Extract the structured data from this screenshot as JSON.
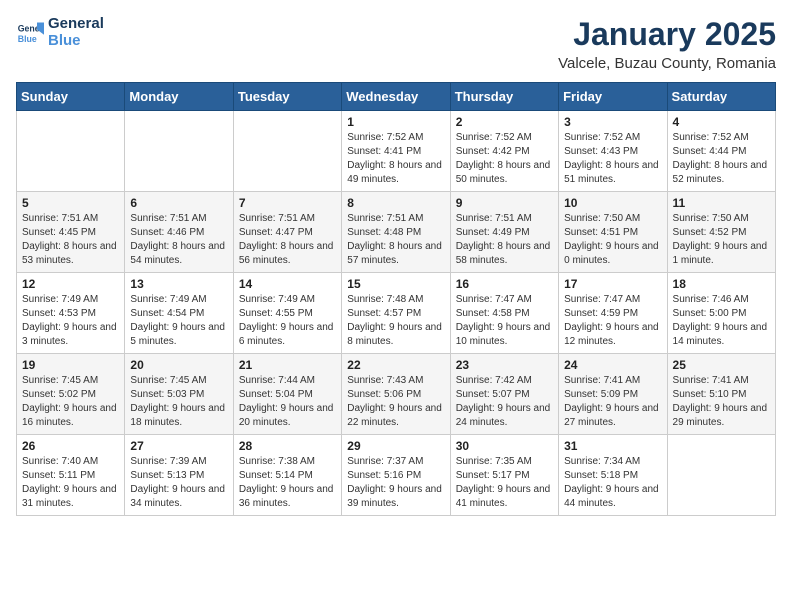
{
  "header": {
    "logo": {
      "line1": "General",
      "line2": "Blue"
    },
    "title": "January 2025",
    "subtitle": "Valcele, Buzau County, Romania"
  },
  "weekdays": [
    "Sunday",
    "Monday",
    "Tuesday",
    "Wednesday",
    "Thursday",
    "Friday",
    "Saturday"
  ],
  "weeks": [
    [
      {
        "day": "",
        "sunrise": "",
        "sunset": "",
        "daylight": ""
      },
      {
        "day": "",
        "sunrise": "",
        "sunset": "",
        "daylight": ""
      },
      {
        "day": "",
        "sunrise": "",
        "sunset": "",
        "daylight": ""
      },
      {
        "day": "1",
        "sunrise": "Sunrise: 7:52 AM",
        "sunset": "Sunset: 4:41 PM",
        "daylight": "Daylight: 8 hours and 49 minutes."
      },
      {
        "day": "2",
        "sunrise": "Sunrise: 7:52 AM",
        "sunset": "Sunset: 4:42 PM",
        "daylight": "Daylight: 8 hours and 50 minutes."
      },
      {
        "day": "3",
        "sunrise": "Sunrise: 7:52 AM",
        "sunset": "Sunset: 4:43 PM",
        "daylight": "Daylight: 8 hours and 51 minutes."
      },
      {
        "day": "4",
        "sunrise": "Sunrise: 7:52 AM",
        "sunset": "Sunset: 4:44 PM",
        "daylight": "Daylight: 8 hours and 52 minutes."
      }
    ],
    [
      {
        "day": "5",
        "sunrise": "Sunrise: 7:51 AM",
        "sunset": "Sunset: 4:45 PM",
        "daylight": "Daylight: 8 hours and 53 minutes."
      },
      {
        "day": "6",
        "sunrise": "Sunrise: 7:51 AM",
        "sunset": "Sunset: 4:46 PM",
        "daylight": "Daylight: 8 hours and 54 minutes."
      },
      {
        "day": "7",
        "sunrise": "Sunrise: 7:51 AM",
        "sunset": "Sunset: 4:47 PM",
        "daylight": "Daylight: 8 hours and 56 minutes."
      },
      {
        "day": "8",
        "sunrise": "Sunrise: 7:51 AM",
        "sunset": "Sunset: 4:48 PM",
        "daylight": "Daylight: 8 hours and 57 minutes."
      },
      {
        "day": "9",
        "sunrise": "Sunrise: 7:51 AM",
        "sunset": "Sunset: 4:49 PM",
        "daylight": "Daylight: 8 hours and 58 minutes."
      },
      {
        "day": "10",
        "sunrise": "Sunrise: 7:50 AM",
        "sunset": "Sunset: 4:51 PM",
        "daylight": "Daylight: 9 hours and 0 minutes."
      },
      {
        "day": "11",
        "sunrise": "Sunrise: 7:50 AM",
        "sunset": "Sunset: 4:52 PM",
        "daylight": "Daylight: 9 hours and 1 minute."
      }
    ],
    [
      {
        "day": "12",
        "sunrise": "Sunrise: 7:49 AM",
        "sunset": "Sunset: 4:53 PM",
        "daylight": "Daylight: 9 hours and 3 minutes."
      },
      {
        "day": "13",
        "sunrise": "Sunrise: 7:49 AM",
        "sunset": "Sunset: 4:54 PM",
        "daylight": "Daylight: 9 hours and 5 minutes."
      },
      {
        "day": "14",
        "sunrise": "Sunrise: 7:49 AM",
        "sunset": "Sunset: 4:55 PM",
        "daylight": "Daylight: 9 hours and 6 minutes."
      },
      {
        "day": "15",
        "sunrise": "Sunrise: 7:48 AM",
        "sunset": "Sunset: 4:57 PM",
        "daylight": "Daylight: 9 hours and 8 minutes."
      },
      {
        "day": "16",
        "sunrise": "Sunrise: 7:47 AM",
        "sunset": "Sunset: 4:58 PM",
        "daylight": "Daylight: 9 hours and 10 minutes."
      },
      {
        "day": "17",
        "sunrise": "Sunrise: 7:47 AM",
        "sunset": "Sunset: 4:59 PM",
        "daylight": "Daylight: 9 hours and 12 minutes."
      },
      {
        "day": "18",
        "sunrise": "Sunrise: 7:46 AM",
        "sunset": "Sunset: 5:00 PM",
        "daylight": "Daylight: 9 hours and 14 minutes."
      }
    ],
    [
      {
        "day": "19",
        "sunrise": "Sunrise: 7:45 AM",
        "sunset": "Sunset: 5:02 PM",
        "daylight": "Daylight: 9 hours and 16 minutes."
      },
      {
        "day": "20",
        "sunrise": "Sunrise: 7:45 AM",
        "sunset": "Sunset: 5:03 PM",
        "daylight": "Daylight: 9 hours and 18 minutes."
      },
      {
        "day": "21",
        "sunrise": "Sunrise: 7:44 AM",
        "sunset": "Sunset: 5:04 PM",
        "daylight": "Daylight: 9 hours and 20 minutes."
      },
      {
        "day": "22",
        "sunrise": "Sunrise: 7:43 AM",
        "sunset": "Sunset: 5:06 PM",
        "daylight": "Daylight: 9 hours and 22 minutes."
      },
      {
        "day": "23",
        "sunrise": "Sunrise: 7:42 AM",
        "sunset": "Sunset: 5:07 PM",
        "daylight": "Daylight: 9 hours and 24 minutes."
      },
      {
        "day": "24",
        "sunrise": "Sunrise: 7:41 AM",
        "sunset": "Sunset: 5:09 PM",
        "daylight": "Daylight: 9 hours and 27 minutes."
      },
      {
        "day": "25",
        "sunrise": "Sunrise: 7:41 AM",
        "sunset": "Sunset: 5:10 PM",
        "daylight": "Daylight: 9 hours and 29 minutes."
      }
    ],
    [
      {
        "day": "26",
        "sunrise": "Sunrise: 7:40 AM",
        "sunset": "Sunset: 5:11 PM",
        "daylight": "Daylight: 9 hours and 31 minutes."
      },
      {
        "day": "27",
        "sunrise": "Sunrise: 7:39 AM",
        "sunset": "Sunset: 5:13 PM",
        "daylight": "Daylight: 9 hours and 34 minutes."
      },
      {
        "day": "28",
        "sunrise": "Sunrise: 7:38 AM",
        "sunset": "Sunset: 5:14 PM",
        "daylight": "Daylight: 9 hours and 36 minutes."
      },
      {
        "day": "29",
        "sunrise": "Sunrise: 7:37 AM",
        "sunset": "Sunset: 5:16 PM",
        "daylight": "Daylight: 9 hours and 39 minutes."
      },
      {
        "day": "30",
        "sunrise": "Sunrise: 7:35 AM",
        "sunset": "Sunset: 5:17 PM",
        "daylight": "Daylight: 9 hours and 41 minutes."
      },
      {
        "day": "31",
        "sunrise": "Sunrise: 7:34 AM",
        "sunset": "Sunset: 5:18 PM",
        "daylight": "Daylight: 9 hours and 44 minutes."
      },
      {
        "day": "",
        "sunrise": "",
        "sunset": "",
        "daylight": ""
      }
    ]
  ]
}
